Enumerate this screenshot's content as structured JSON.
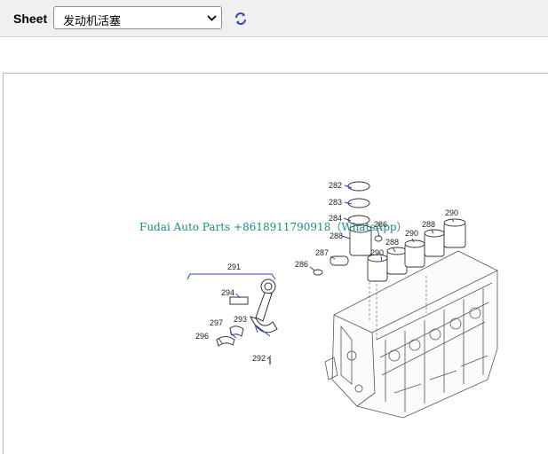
{
  "toolbar": {
    "sheet_label": "Sheet",
    "sheet_select": {
      "value": "发动机活塞",
      "icon": "chevron-down-icon"
    },
    "refresh_icon": "refresh-icon",
    "refresh_color": "#3a46c4"
  },
  "drawing": {
    "callouts": {
      "c282": "282",
      "c283": "283",
      "c284": "284",
      "c288a": "288",
      "c287": "287",
      "c286a": "286",
      "c286b": "286",
      "c291": "291",
      "c294": "294",
      "c293": "293",
      "c297": "297",
      "c296": "296",
      "c292": "292",
      "c290a": "290",
      "c288b": "288",
      "c290b": "290",
      "c288c": "288",
      "c290c": "290"
    },
    "leader_color": "#2b3fd1"
  },
  "watermark": "Fudai Auto Parts +8618911790918（WhatsApp）"
}
